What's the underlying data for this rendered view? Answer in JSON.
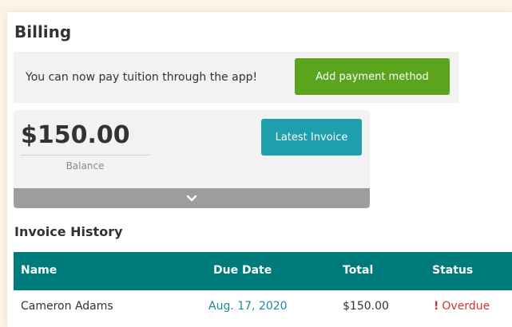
{
  "billing": {
    "title": "Billing",
    "promo": {
      "text": "You can now pay tuition through the app!",
      "button_label": "Add payment method"
    },
    "balance": {
      "amount": "$150.00",
      "label": "Balance",
      "invoice_button_label": "Latest Invoice",
      "expand_icon": "chevron-down-icon"
    }
  },
  "invoice_history": {
    "title": "Invoice History",
    "columns": [
      "Name",
      "Due Date",
      "Total",
      "Status"
    ],
    "rows": [
      {
        "name": "Cameron Adams",
        "due_date": "Aug. 17, 2020",
        "total": "$150.00",
        "status": "Overdue",
        "status_icon": "exclamation-icon"
      }
    ]
  },
  "colors": {
    "primary_button": "#5aa41e",
    "invoice_button": "#1d9fae",
    "table_header": "#007b7b",
    "link": "#1a8a9c",
    "overdue": "#d0342c"
  }
}
